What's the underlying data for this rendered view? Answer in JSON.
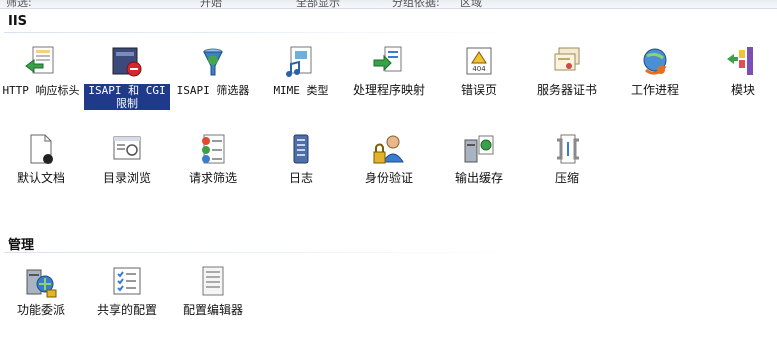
{
  "top_strip": {
    "items": [
      "筛选:",
      "开始",
      "全部显示",
      "分组依据:",
      "区域"
    ]
  },
  "groups": [
    {
      "title": "IIS",
      "features": [
        {
          "label": "HTTP 响应标头",
          "icon": "http-response-headers-icon"
        },
        {
          "label": "ISAPI 和 CGI 限制",
          "icon": "isapi-cgi-restrictions-icon",
          "selected": true
        },
        {
          "label": "ISAPI 筛选器",
          "icon": "isapi-filters-icon"
        },
        {
          "label": "MIME 类型",
          "icon": "mime-types-icon"
        },
        {
          "label": "处理程序映射",
          "icon": "handler-mappings-icon"
        },
        {
          "label": "错误页",
          "icon": "error-pages-icon"
        },
        {
          "label": "服务器证书",
          "icon": "server-certificates-icon"
        },
        {
          "label": "工作进程",
          "icon": "worker-processes-icon"
        },
        {
          "label": "模块",
          "icon": "modules-icon"
        },
        {
          "label": "默认文档",
          "icon": "default-document-icon"
        },
        {
          "label": "目录浏览",
          "icon": "directory-browsing-icon"
        },
        {
          "label": "请求筛选",
          "icon": "request-filtering-icon"
        },
        {
          "label": "日志",
          "icon": "logging-icon"
        },
        {
          "label": "身份验证",
          "icon": "authentication-icon"
        },
        {
          "label": "输出缓存",
          "icon": "output-caching-icon"
        },
        {
          "label": "压缩",
          "icon": "compression-icon"
        }
      ]
    },
    {
      "title": "管理",
      "features": [
        {
          "label": "功能委派",
          "icon": "feature-delegation-icon"
        },
        {
          "label": "共享的配置",
          "icon": "shared-configuration-icon"
        },
        {
          "label": "配置编辑器",
          "icon": "configuration-editor-icon"
        }
      ]
    }
  ]
}
